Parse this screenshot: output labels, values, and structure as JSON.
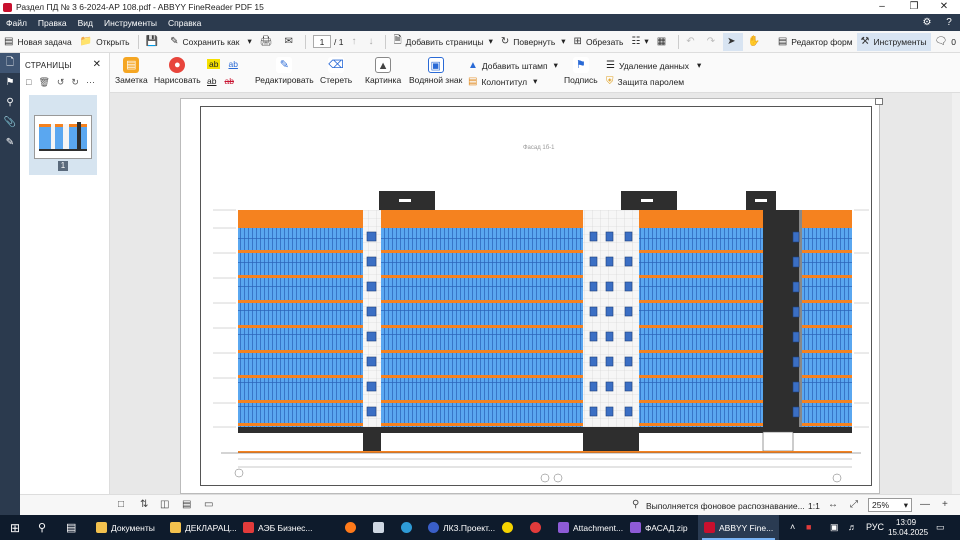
{
  "window": {
    "title": "Раздел ПД № 3 6-2024-АР 108.pdf - ABBYY FineReader PDF 15",
    "min_icon": "minimize-icon",
    "max_icon": "restore-icon",
    "close_icon": "close-icon"
  },
  "menu": {
    "items": [
      "Файл",
      "Правка",
      "Вид",
      "Инструменты",
      "Справка"
    ]
  },
  "toolbar": {
    "new_task": "Новая задача",
    "open": "Открыть",
    "save_as": "Сохранить как",
    "page_current": "1",
    "page_total": "/ 1",
    "add_pages": "Добавить страницы",
    "rotate": "Повернуть",
    "crop": "Обрезать",
    "form_editor": "Редактор форм",
    "tools": "Инструменты",
    "comments_count": "0"
  },
  "ribbon": {
    "note": "Заметка",
    "draw": "Нарисовать",
    "edit": "Редактировать",
    "erase": "Стереть",
    "image": "Картинка",
    "watermark": "Водяной знак",
    "add_stamp": "Добавить штамп",
    "header_footer": "Колонтитул",
    "signature": "Подпись",
    "remove_data": "Удаление данных",
    "password_protect": "Защита паролем",
    "ab": "ab"
  },
  "panel": {
    "title": "СТРАНИЦЫ",
    "thumb_page": "1"
  },
  "document": {
    "facade_label": "Фасад 1б-1",
    "colors": {
      "orange": "#f5821f",
      "glass": "#5aa7f0",
      "dark": "#2e2e2e",
      "light": "#f4f4f4"
    }
  },
  "status": {
    "recognition": "Выполняется фоновое распознавание...",
    "ratio": "1:1",
    "zoom": "25%"
  },
  "taskbar": {
    "apps": [
      {
        "label": "Документы",
        "color": "#f2c14e"
      },
      {
        "label": "ДЕКЛАРАЦ...",
        "color": "#f2c14e"
      },
      {
        "label": "АЭБ Бизнес...",
        "color": "#e23b3b"
      },
      {
        "label": "",
        "color": "#ff7a1a"
      },
      {
        "label": "",
        "color": "#cfd8e3"
      },
      {
        "label": "",
        "color": "#2e9bd6"
      },
      {
        "label": "ЛКЗ.Проект...",
        "color": "#3a5fc8"
      },
      {
        "label": "",
        "color": "#f5d300"
      },
      {
        "label": "",
        "color": "#e23b3b"
      },
      {
        "label": "Attachment...",
        "color": "#8e5bd6"
      },
      {
        "label": "ФАСАД.zip",
        "color": "#8e5bd6"
      },
      {
        "label": "ABBYY Fine...",
        "color": "#c8102e"
      }
    ],
    "lang": "РУС",
    "time": "13:09",
    "date": "15.04.2025"
  }
}
